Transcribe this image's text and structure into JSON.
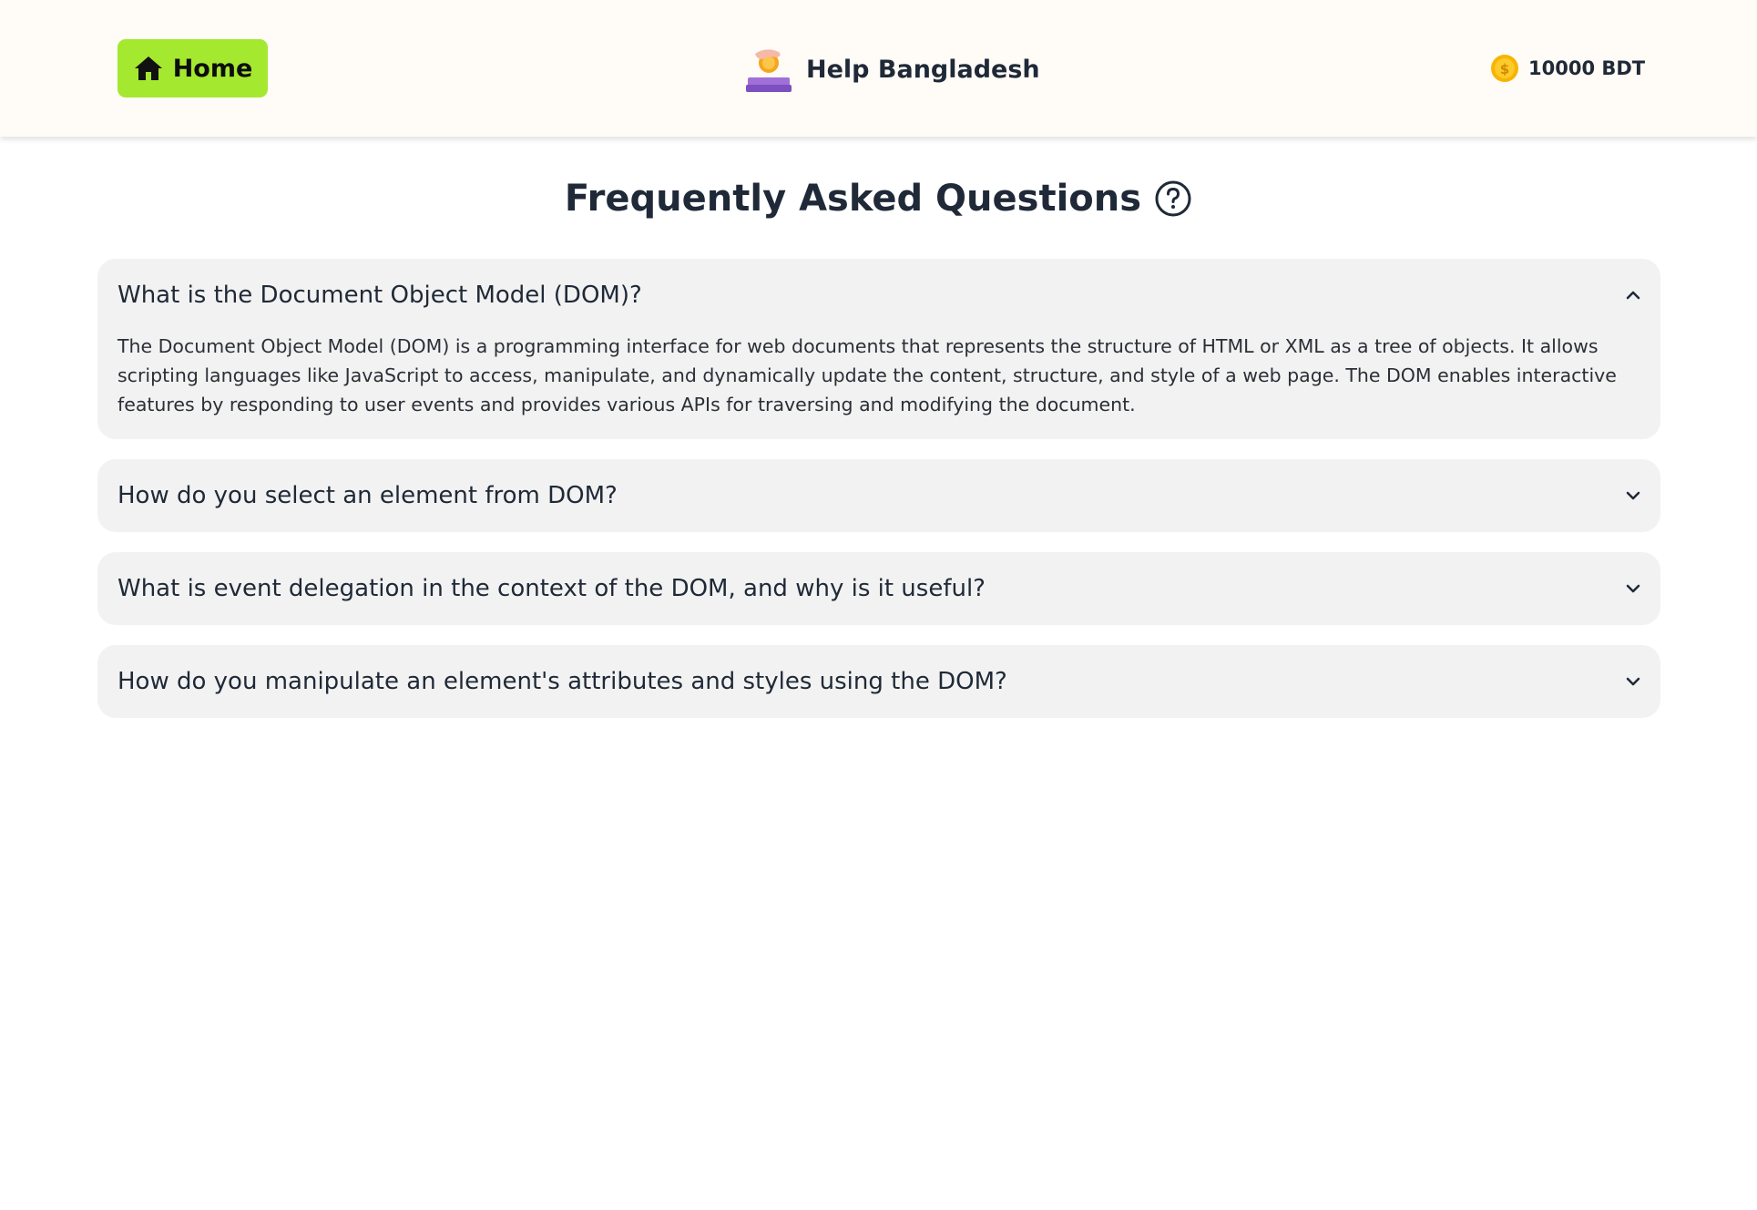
{
  "header": {
    "home_label": "Home",
    "brand_name": "Help Bangladesh",
    "balance": "10000 BDT"
  },
  "faq": {
    "title": "Frequently Asked Questions",
    "items": [
      {
        "question": "What is the Document Object Model (DOM)?",
        "answer": "The Document Object Model (DOM) is a programming interface for web documents that represents the structure of HTML or XML as a tree of objects. It allows scripting languages like JavaScript to access, manipulate, and dynamically update the content, structure, and style of a web page. The DOM enables interactive features by responding to user events and provides various APIs for traversing and modifying the document.",
        "expanded": true
      },
      {
        "question": "How do you select an element from DOM?",
        "expanded": false
      },
      {
        "question": "What is event delegation in the context of the DOM, and why is it useful?",
        "expanded": false
      },
      {
        "question": "How do you manipulate an element's attributes and styles using the DOM?",
        "expanded": false
      }
    ]
  },
  "colors": {
    "header_bg": "#fffbf6",
    "home_button": "#a5e830",
    "card_bg": "#f2f2f2",
    "text": "#1f2937"
  },
  "icons": {
    "home": "home-icon",
    "logo": "donation-hand-coin-icon",
    "coin": "coin-icon",
    "title": "question-circle-icon",
    "expanded": "chevron-up-icon",
    "collapsed": "chevron-down-icon"
  }
}
